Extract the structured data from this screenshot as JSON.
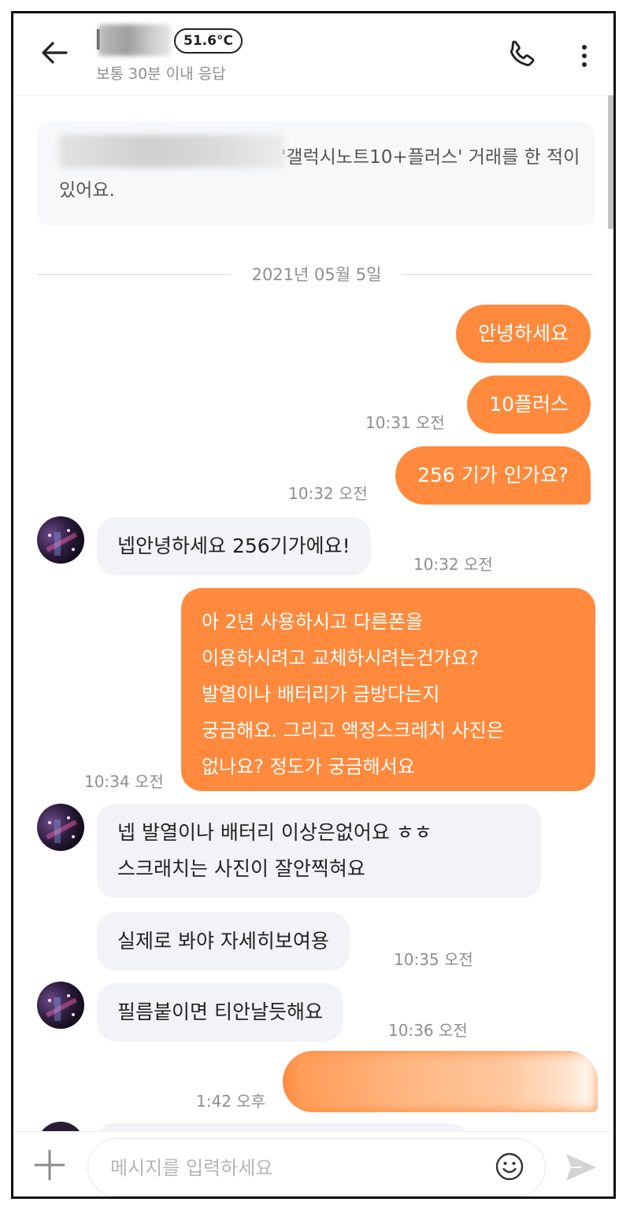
{
  "header": {
    "temperature": "51.6°C",
    "response_time": "보통 30분 이내 응답"
  },
  "notice": {
    "text": "'갤럭시노트10+플러스' 거래를 한 적이 있어요."
  },
  "date_separator": "2021년 05월 5일",
  "messages": [
    {
      "sender": "me",
      "text": "안녕하세요",
      "time": ""
    },
    {
      "sender": "me",
      "text": "10플러스",
      "time": "10:31 오전"
    },
    {
      "sender": "me",
      "text": "256 기가 인가요?",
      "time": "10:32 오전"
    },
    {
      "sender": "them",
      "text": "넵안녕하세요 256기가에요!",
      "time": "10:32 오전"
    },
    {
      "sender": "me",
      "lines": [
        "아 2년 사용하시고 다른폰을",
        "이용하시려고 교체하시려는건가요?",
        "발열이나  배터리가 금방다는지",
        "궁금해요. 그리고 액정스크레치 사진은",
        "없나요? 정도가 궁금해서요"
      ],
      "time": "10:34 오전"
    },
    {
      "sender": "them",
      "lines": [
        "넵 발열이나 배터리 이상은없어요 ㅎㅎ",
        "스크래치는 사진이 잘안찍혀요"
      ],
      "time": ""
    },
    {
      "sender": "them",
      "text": "실제로 봐야 자세히보여용",
      "time": "10:35 오전"
    },
    {
      "sender": "them",
      "text": "필름붙이면 티안날듯해요",
      "time": "10:36 오전"
    },
    {
      "sender": "me",
      "text": "",
      "time": "1:42 오후"
    }
  ],
  "input": {
    "placeholder": "메시지를 입력하세요"
  },
  "icons": {
    "back": "arrow-left-icon",
    "call": "phone-icon",
    "more": "more-vertical-icon",
    "attach": "plus-icon",
    "emoji": "smiley-icon",
    "send": "send-icon"
  },
  "colors": {
    "my_bubble": "#ff8a3d",
    "their_bubble": "#f2f3f6",
    "meta_text": "#8e8e8e"
  }
}
